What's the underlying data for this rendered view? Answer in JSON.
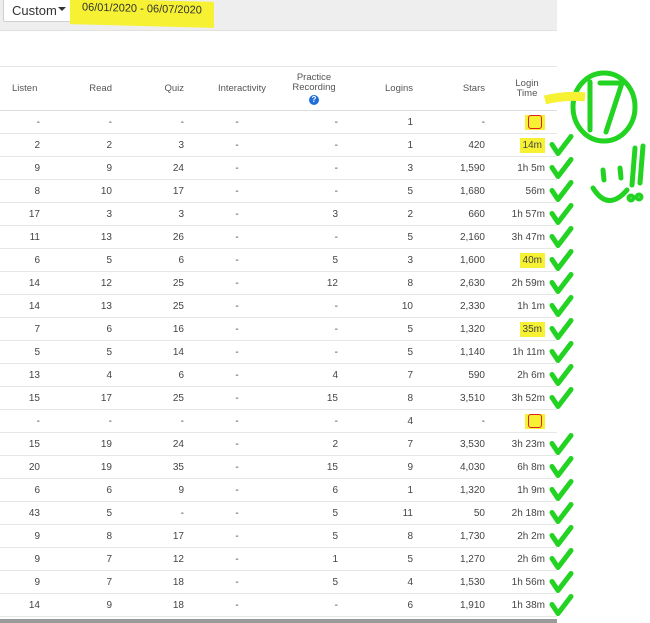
{
  "toolbar": {
    "range_option": "Custom",
    "date_range": "06/01/2020 - 06/07/2020"
  },
  "table": {
    "columns": [
      "Listen",
      "Read",
      "Quiz",
      "Interactivity",
      "Practice Recording",
      "Logins",
      "Stars",
      "Login Time"
    ],
    "rows": [
      [
        "-",
        "-",
        "-",
        "-",
        "-",
        "1",
        "-",
        ""
      ],
      [
        "2",
        "2",
        "3",
        "-",
        "-",
        "1",
        "420",
        "14m"
      ],
      [
        "9",
        "9",
        "24",
        "-",
        "-",
        "3",
        "1,590",
        "1h 5m"
      ],
      [
        "8",
        "10",
        "17",
        "-",
        "-",
        "5",
        "1,680",
        "56m"
      ],
      [
        "17",
        "3",
        "3",
        "-",
        "3",
        "2",
        "660",
        "1h 57m"
      ],
      [
        "11",
        "13",
        "26",
        "-",
        "-",
        "5",
        "2,160",
        "3h 47m"
      ],
      [
        "6",
        "5",
        "6",
        "-",
        "5",
        "3",
        "1,600",
        "40m"
      ],
      [
        "14",
        "12",
        "25",
        "-",
        "12",
        "8",
        "2,630",
        "2h 59m"
      ],
      [
        "14",
        "13",
        "25",
        "-",
        "-",
        "10",
        "2,330",
        "1h 1m"
      ],
      [
        "7",
        "6",
        "16",
        "-",
        "-",
        "5",
        "1,320",
        "35m"
      ],
      [
        "5",
        "5",
        "14",
        "-",
        "-",
        "5",
        "1,140",
        "1h 11m"
      ],
      [
        "13",
        "4",
        "6",
        "-",
        "4",
        "7",
        "590",
        "2h 6m"
      ],
      [
        "15",
        "17",
        "25",
        "-",
        "15",
        "8",
        "3,510",
        "3h 52m"
      ],
      [
        "-",
        "-",
        "-",
        "-",
        "-",
        "4",
        "-",
        ""
      ],
      [
        "15",
        "19",
        "24",
        "-",
        "2",
        "7",
        "3,530",
        "3h 23m"
      ],
      [
        "20",
        "19",
        "35",
        "-",
        "15",
        "9",
        "4,030",
        "6h 8m"
      ],
      [
        "6",
        "6",
        "9",
        "-",
        "6",
        "1",
        "1,320",
        "1h 9m"
      ],
      [
        "43",
        "5",
        "-",
        "-",
        "5",
        "11",
        "50",
        "2h 18m"
      ],
      [
        "9",
        "8",
        "17",
        "-",
        "5",
        "8",
        "1,730",
        "2h 2m"
      ],
      [
        "9",
        "7",
        "12",
        "-",
        "1",
        "5",
        "1,270",
        "2h 6m"
      ],
      [
        "9",
        "7",
        "18",
        "-",
        "5",
        "4",
        "1,530",
        "1h 56m"
      ],
      [
        "14",
        "9",
        "18",
        "-",
        "-",
        "6",
        "1,910",
        "1h 38m"
      ]
    ],
    "highlighted_rows": [
      1,
      6,
      9
    ],
    "empty_marked_rows": [
      0,
      13
    ]
  },
  "annotation": {
    "count": "17",
    "exclaim": "!!",
    "color": "#22d322",
    "highlight_color": "#f6f233",
    "mark_color": "#e02020"
  }
}
